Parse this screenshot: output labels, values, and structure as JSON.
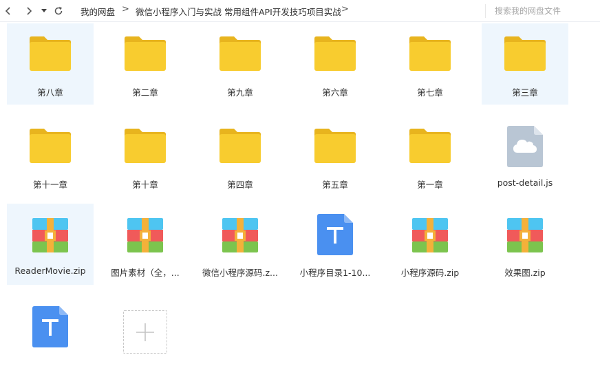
{
  "nav": {
    "back_icon": "chevron-left-icon",
    "forward_icon": "chevron-right-icon",
    "history_icon": "caret-down-icon",
    "refresh_icon": "refresh-icon"
  },
  "breadcrumb": {
    "items": [
      "我的网盘",
      "微信小程序入门与实战 常用组件API开发技巧项目实战"
    ],
    "separator": ">"
  },
  "search": {
    "placeholder": "搜索我的网盘文件"
  },
  "colors": {
    "folder_body": "#f8cc2f",
    "folder_tab": "#e8b41e",
    "zip_red": "#f05a5a",
    "zip_blue": "#4ec5f1",
    "zip_green": "#7cc44e",
    "zip_strap": "#f4b13a",
    "txt_blue": "#4a90f0",
    "js_gray": "#b9c6d4",
    "selected_bg": "#eef6fd"
  },
  "files": [
    {
      "name": "第八章",
      "type": "folder",
      "icon": "folder-icon",
      "selected": true
    },
    {
      "name": "第二章",
      "type": "folder",
      "icon": "folder-icon",
      "selected": false
    },
    {
      "name": "第九章",
      "type": "folder",
      "icon": "folder-icon",
      "selected": false
    },
    {
      "name": "第六章",
      "type": "folder",
      "icon": "folder-icon",
      "selected": false
    },
    {
      "name": "第七章",
      "type": "folder",
      "icon": "folder-icon",
      "selected": false
    },
    {
      "name": "第三章",
      "type": "folder",
      "icon": "folder-icon",
      "selected": true
    },
    {
      "name": "第十一章",
      "type": "folder",
      "icon": "folder-icon",
      "selected": false
    },
    {
      "name": "第十章",
      "type": "folder",
      "icon": "folder-icon",
      "selected": false
    },
    {
      "name": "第四章",
      "type": "folder",
      "icon": "folder-icon",
      "selected": false
    },
    {
      "name": "第五章",
      "type": "folder",
      "icon": "folder-icon",
      "selected": false
    },
    {
      "name": "第一章",
      "type": "folder",
      "icon": "folder-icon",
      "selected": false
    },
    {
      "name": "post-detail.js",
      "type": "js",
      "icon": "cloud-file-icon",
      "selected": false
    },
    {
      "name": "ReaderMovie.zip",
      "type": "zip",
      "icon": "zip-archive-icon",
      "selected": true
    },
    {
      "name": "图片素材（全，...",
      "type": "zip",
      "icon": "zip-archive-icon",
      "selected": false
    },
    {
      "name": "微信小程序源码.z...",
      "type": "zip",
      "icon": "zip-archive-icon",
      "selected": false
    },
    {
      "name": "小程序目录1-10...",
      "type": "txt",
      "icon": "text-document-icon",
      "selected": false
    },
    {
      "name": "小程序源码.zip",
      "type": "zip",
      "icon": "zip-archive-icon",
      "selected": false
    },
    {
      "name": "效果图.zip",
      "type": "zip",
      "icon": "zip-archive-icon",
      "selected": false
    },
    {
      "name": "",
      "type": "txt",
      "icon": "text-document-icon",
      "selected": false
    }
  ],
  "add_tile": {
    "icon": "plus-icon"
  }
}
